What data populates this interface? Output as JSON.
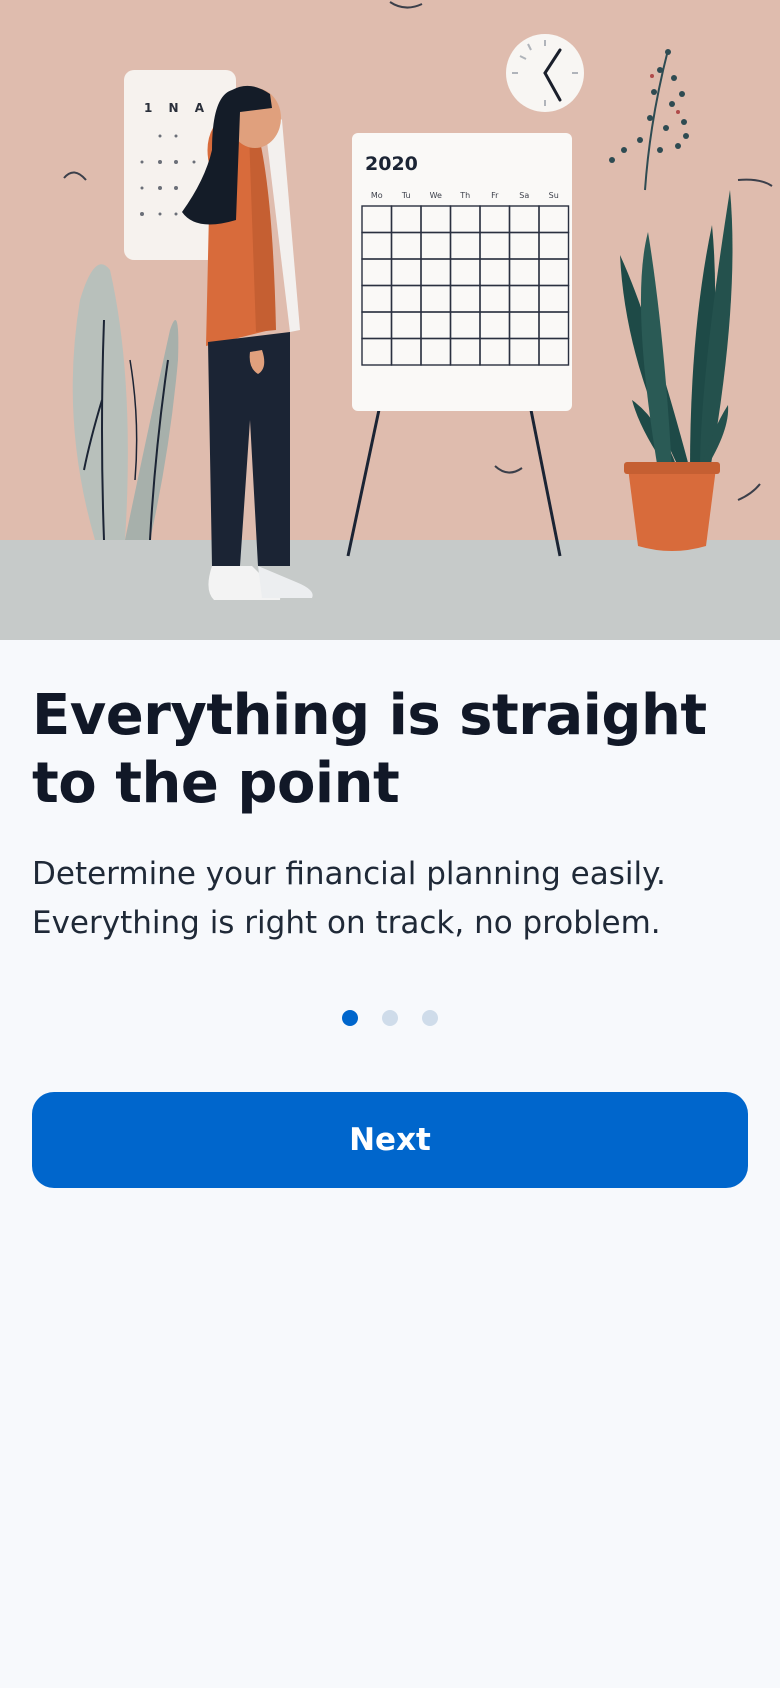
{
  "onboarding": {
    "illustration": {
      "icon": "woman-planning-calendar-illustration",
      "calendar_year": "2020",
      "calendar_days": [
        "Mo",
        "Tu",
        "We",
        "Th",
        "Fr",
        "Sa",
        "Su"
      ],
      "wall_calendar_text": "1 N A",
      "colors": {
        "wall": "#dfbcae",
        "floor": "#c6cac9",
        "sweater": "#d86b3b",
        "pants": "#1b2434",
        "hair": "#141c28",
        "plant_dark": "#1e4a47",
        "plant_light": "#b8c0bb",
        "pot": "#d86b3b"
      }
    },
    "title": "Everything is straight to the point",
    "subtitle": "Determine your financial planning easily. Everything is right on track, no problem.",
    "pagination": {
      "total": 3,
      "active_index": 0
    },
    "next_label": "Next"
  },
  "theme": {
    "background": "#f7f9fc",
    "primary": "#0066cc",
    "dot_inactive": "#cfdcea",
    "text": "#111827"
  }
}
